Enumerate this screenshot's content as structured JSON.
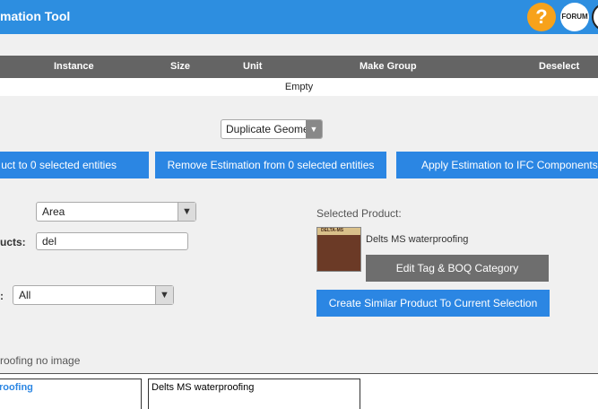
{
  "header": {
    "title": "mation Tool",
    "help_label": "?",
    "forum_label": "FORUM"
  },
  "table": {
    "columns": [
      "Instance",
      "Size",
      "Unit",
      "Make Group",
      "Deselect"
    ],
    "empty_text": "Empty"
  },
  "geometry_select": {
    "value": "Duplicate Geometry"
  },
  "actions": {
    "apply_selected": "uct to 0 selected entities",
    "remove_estimation": "Remove Estimation from 0 selected entities",
    "apply_ifc": "Apply Estimation to IFC Components"
  },
  "form": {
    "unit_select_value": "Area",
    "products_label": "ucts:",
    "search_value": "del",
    "filter_label": ":",
    "filter_select_value": "All"
  },
  "selected_product": {
    "heading": "Selected Product:",
    "name": "Delts MS waterproofing",
    "thumb_text": "DELTA-MS",
    "edit_button": "Edit Tag & BOQ Category",
    "create_similar_button": "Create Similar Product To Current Selection"
  },
  "results": {
    "summary": "roofing no image",
    "cells": [
      "roofing",
      "Delts MS waterproofing"
    ]
  },
  "colors": {
    "header": "#2d8ee0",
    "accent_blue": "#2b86e3",
    "help_orange": "#f7a21b",
    "table_header": "#646464",
    "gray_button": "#6e6e6e"
  }
}
